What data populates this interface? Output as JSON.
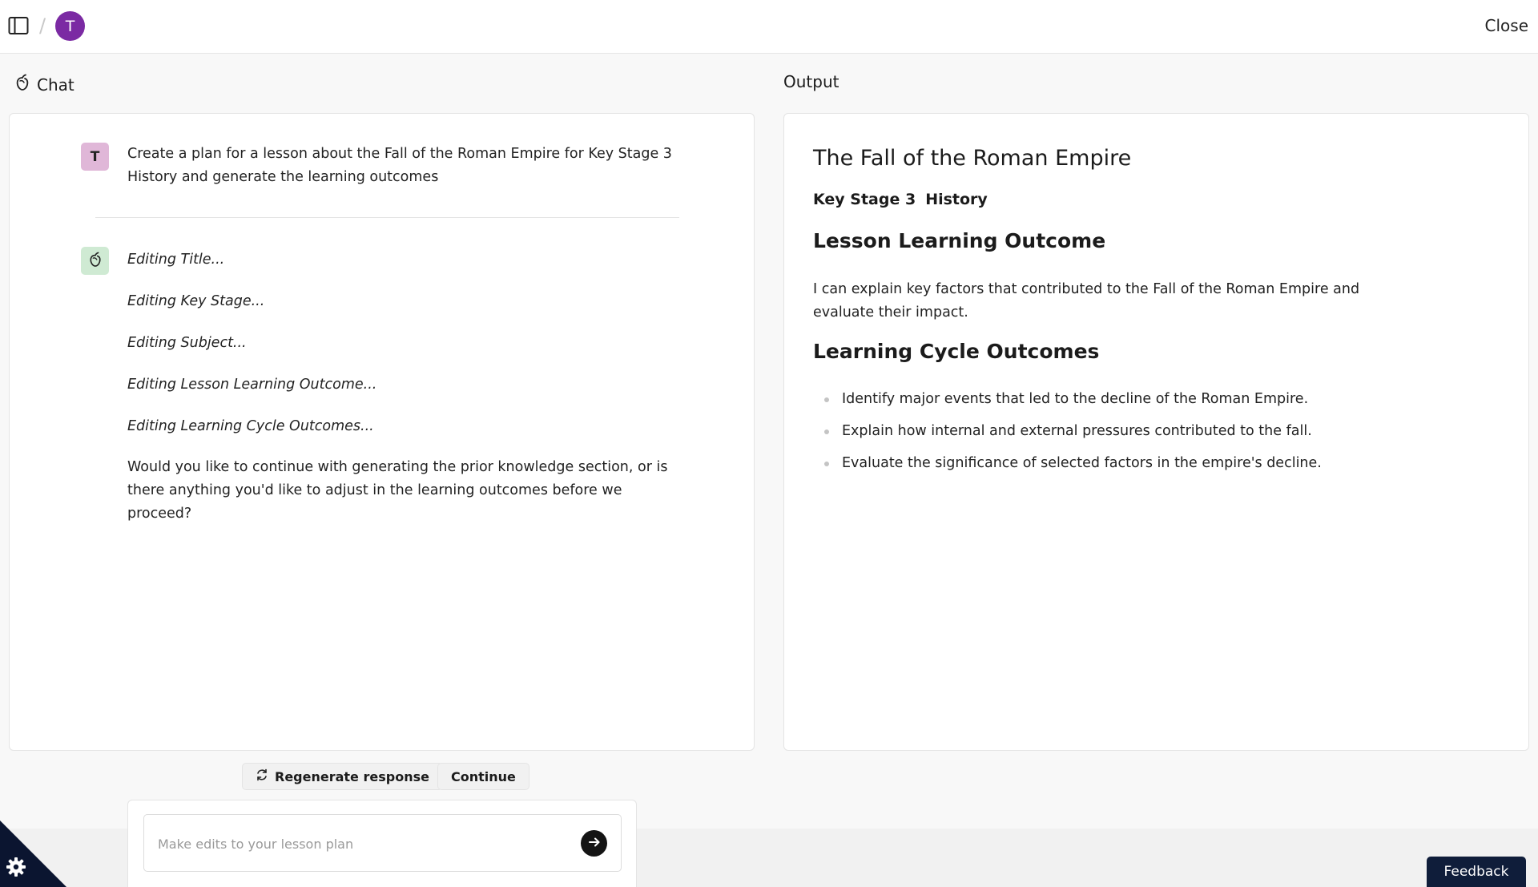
{
  "topbar": {
    "avatar_initial": "T",
    "separator": "/",
    "close_label": "Close"
  },
  "chat": {
    "heading": "Chat",
    "user_avatar": "T",
    "user_message": "Create a plan for a lesson about the Fall of the Roman Empire for Key Stage 3 History and generate the learning outcomes",
    "bot_edits": [
      "Editing Title...",
      "Editing Key Stage...",
      "Editing Subject...",
      "Editing Lesson Learning Outcome...",
      "Editing Learning Cycle Outcomes..."
    ],
    "bot_final": "Would you like to continue with generating the prior knowledge section, or is there anything you'd like to adjust in the learning outcomes before we proceed?"
  },
  "output": {
    "heading": "Output",
    "title": "The Fall of the Roman Empire",
    "key_stage": "Key Stage 3",
    "subject": "History",
    "lesson_outcome_heading": "Lesson Learning Outcome",
    "lesson_outcome_text": "I can explain key factors that contributed to the Fall of the Roman Empire and evaluate their impact.",
    "cycle_heading": "Learning Cycle Outcomes",
    "cycle_items": [
      "Identify major events that led to the decline of the Roman Empire.",
      "Explain how internal and external pressures contributed to the fall.",
      "Evaluate the significance of selected factors in the empire's decline."
    ]
  },
  "actions": {
    "regenerate_label": "Regenerate response",
    "continue_label": "Continue"
  },
  "input": {
    "placeholder": "Make edits to your lesson plan",
    "value": ""
  },
  "feedback_label": "Feedback"
}
